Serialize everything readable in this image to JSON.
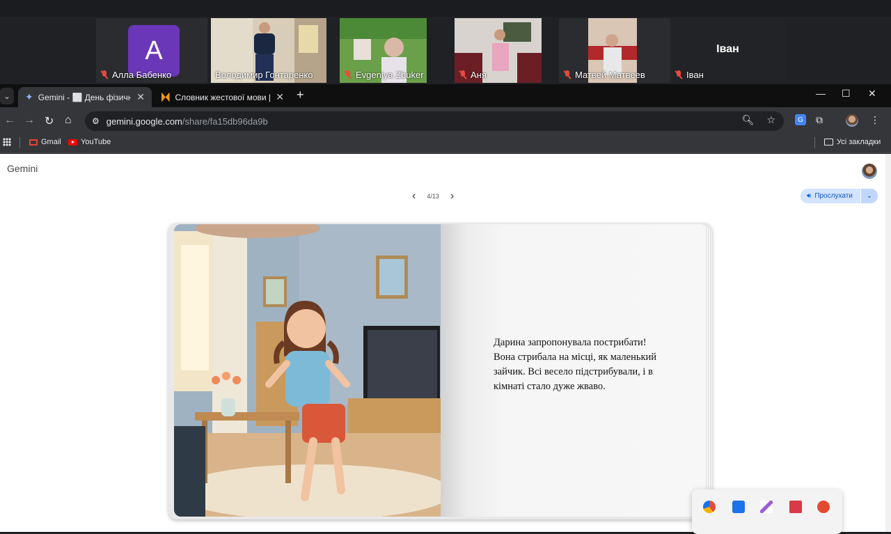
{
  "call": {
    "participants": [
      {
        "name": "Алла Бабенко",
        "avatar_letter": "A"
      },
      {
        "name": "Володимир Гонтаренко"
      },
      {
        "name": "Evgeniya Zbuker"
      },
      {
        "name": "Аня"
      },
      {
        "name": "Матвей Матвеев"
      },
      {
        "name": "Іван",
        "tile_label": "Іван"
      }
    ]
  },
  "browser": {
    "tabs": [
      {
        "title": "Gemini - ⬜ День фізичної куль",
        "icon": "gemini-icon"
      },
      {
        "title": "Словник жестової мови | Spre",
        "icon": "spreadthesign-icon"
      }
    ],
    "new_tab": "+",
    "window_controls": {
      "minimize": "—",
      "maximize": "☐",
      "close": "✕"
    },
    "url_host": "gemini.google.com",
    "url_path": "/share/fa15db96da9b",
    "bookmarks": [
      {
        "label": "Gmail",
        "icon": "gmail-icon"
      },
      {
        "label": "YouTube",
        "icon": "youtube-icon"
      }
    ],
    "all_bookmarks": "Усі закладки"
  },
  "page": {
    "app_title": "Gemini",
    "pager": {
      "current": "4/13"
    },
    "listen_label": "Прослухати",
    "story_text": "Дарина запропонувала пострибати! Вона стрибала на місці, як маленький зайчик. Всі весело підстрибували, і в кімнаті стало дуже жваво."
  },
  "colors": {
    "active_speaker_outline": "#2fd27a",
    "listen_button_bg": "#d3e3fd",
    "listen_button_text": "#0b57d0",
    "avatar_purple": "#6a37b8"
  }
}
